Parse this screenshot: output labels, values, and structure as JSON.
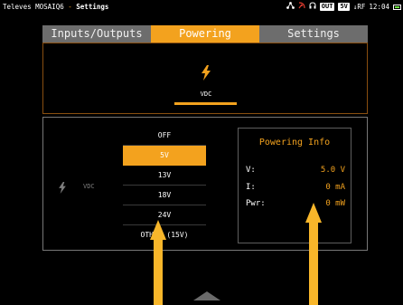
{
  "statusbar": {
    "brand": "Televes MOSAIQ",
    "brand_mark": "6",
    "separator": " - ",
    "page": "Settings",
    "icons": [
      "network-icon",
      "satellite-dish-icon",
      "headphones-icon"
    ],
    "out_badge": "OUT",
    "voltage_badge": "5V",
    "rf_label": "↓RF",
    "clock": "12:04"
  },
  "tabs": [
    {
      "label": "Inputs/Outputs",
      "active": false
    },
    {
      "label": "Powering",
      "active": true
    },
    {
      "label": "Settings",
      "active": false
    }
  ],
  "powering": {
    "mode_label": "VDC",
    "side_label": "VDC",
    "options": [
      "OFF",
      "5V",
      "13V",
      "18V",
      "24V",
      "OTHER (15V)"
    ],
    "selected_index": 1
  },
  "info": {
    "title": "Powering Info",
    "rows": [
      {
        "label": "V:",
        "value": "5.0 V"
      },
      {
        "label": "I:",
        "value": "0 mA"
      },
      {
        "label": "Pwr:",
        "value": "0 mW"
      }
    ]
  },
  "colors": {
    "accent": "#f3a21e",
    "tab_inactive": "#6d6d6d",
    "background": "#000000"
  }
}
